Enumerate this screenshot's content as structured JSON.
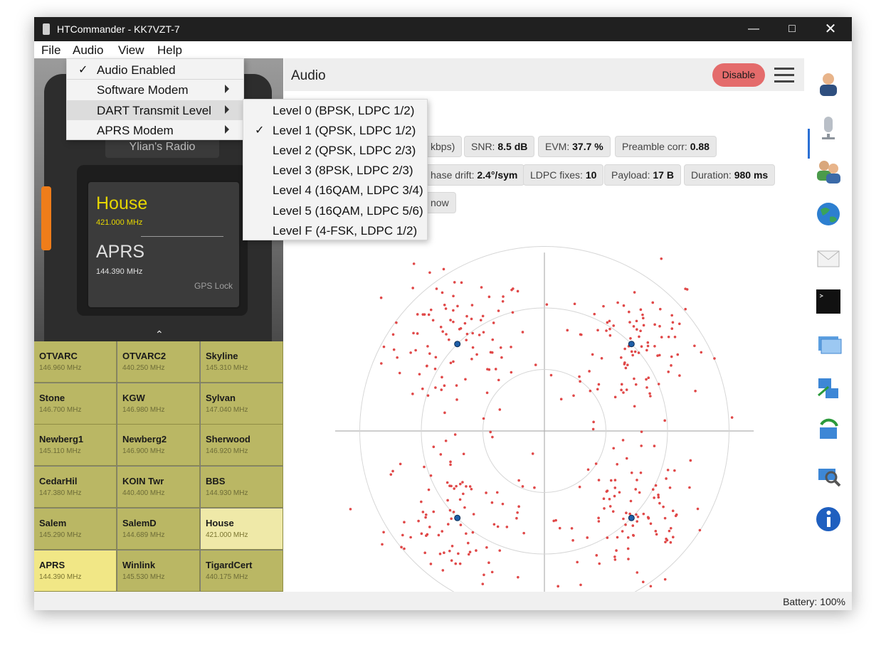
{
  "window": {
    "title": "HTCommander - KK7VZT-7"
  },
  "menubar": [
    "File",
    "Audio",
    "View",
    "Help"
  ],
  "audio_menu": [
    {
      "label": "Audio Enabled",
      "checked": true,
      "submenu": false
    },
    {
      "label": "Software Modem",
      "checked": false,
      "submenu": true
    },
    {
      "label": "DART Transmit Level",
      "checked": false,
      "submenu": true,
      "highlighted": true
    },
    {
      "label": "APRS Modem",
      "checked": false,
      "submenu": true
    }
  ],
  "dart_submenu": [
    {
      "label": "Level 0 (BPSK, LDPC 1/2)",
      "checked": false
    },
    {
      "label": "Level 1 (QPSK, LDPC 1/2)",
      "checked": true
    },
    {
      "label": "Level 2 (QPSK, LDPC 2/3)",
      "checked": false
    },
    {
      "label": "Level 3 (8PSK, LDPC 2/3)",
      "checked": false
    },
    {
      "label": "Level 4 (16QAM, LDPC 3/4)",
      "checked": false
    },
    {
      "label": "Level 5 (16QAM, LDPC 5/6)",
      "checked": false
    },
    {
      "label": "Level F (4-FSK, LDPC 1/2)",
      "checked": false
    }
  ],
  "radio": {
    "name": "Ylian's Radio",
    "channel_a": {
      "name": "House",
      "freq": "421.000 MHz"
    },
    "channel_b": {
      "name": "APRS",
      "freq": "144.390 MHz"
    },
    "gps": "GPS Lock"
  },
  "channels": [
    {
      "name": "OTVARC",
      "freq": "146.960 MHz"
    },
    {
      "name": "OTVARC2",
      "freq": "440.250 MHz"
    },
    {
      "name": "Skyline",
      "freq": "145.310 MHz"
    },
    {
      "name": "Stone",
      "freq": "146.700 MHz"
    },
    {
      "name": "KGW",
      "freq": "146.980 MHz"
    },
    {
      "name": "Sylvan",
      "freq": "147.040 MHz"
    },
    {
      "name": "Newberg1",
      "freq": "145.110 MHz"
    },
    {
      "name": "Newberg2",
      "freq": "146.900 MHz"
    },
    {
      "name": "Sherwood",
      "freq": "146.920 MHz"
    },
    {
      "name": "CedarHil",
      "freq": "147.380 MHz"
    },
    {
      "name": "KOIN Twr",
      "freq": "440.400 MHz"
    },
    {
      "name": "BBS",
      "freq": "144.930 MHz"
    },
    {
      "name": "Salem",
      "freq": "145.290 MHz"
    },
    {
      "name": "SalemD",
      "freq": "144.689 MHz"
    },
    {
      "name": "House",
      "freq": "421.000 MHz",
      "state": "selected-a"
    },
    {
      "name": "APRS",
      "freq": "144.390 MHz",
      "state": "selected-b"
    },
    {
      "name": "Winlink",
      "freq": "145.530 MHz"
    },
    {
      "name": "TigardCert",
      "freq": "440.175 MHz"
    }
  ],
  "audio_panel": {
    "title": "Audio",
    "disable_label": "Disable",
    "stats": [
      {
        "text": "kbps)"
      },
      {
        "label": "SNR: ",
        "value": "8.5 dB"
      },
      {
        "label": "EVM: ",
        "value": "37.7 %"
      },
      {
        "label": "Preamble corr: ",
        "value": "0.88"
      },
      {
        "label": "hase drift: ",
        "value": "2.4°/sym"
      },
      {
        "label": "LDPC fixes: ",
        "value": "10"
      },
      {
        "label": "Payload: ",
        "value": "17 B"
      },
      {
        "label": "Duration: ",
        "value": "980 ms"
      },
      {
        "text": "now"
      }
    ]
  },
  "sidebar_icons": [
    "contact-icon",
    "microphone-icon",
    "users-icon",
    "globe-icon",
    "mail-icon",
    "terminal-icon",
    "windows-icon",
    "network-icon",
    "sync-icon",
    "search-icon",
    "info-icon"
  ],
  "colors": {
    "accent": "#2a6fd4",
    "disable": "#e46b6b",
    "channel": "#bab764",
    "channel_selected": "#efe9a8",
    "dot": "#e04848",
    "ref_dot": "#1f5fa8"
  },
  "chart_data": {
    "type": "scatter",
    "title": "",
    "xlabel": "",
    "ylabel": "",
    "xlim": [
      -1.7,
      1.7
    ],
    "ylim": [
      -1.45,
      1.45
    ],
    "rings": [
      0.5,
      1.0,
      1.5
    ],
    "reference_points": [
      [
        -0.707,
        0.707
      ],
      [
        0.707,
        0.707
      ],
      [
        -0.707,
        -0.707
      ],
      [
        0.707,
        -0.707
      ]
    ],
    "samples": {
      "count": 400,
      "clusters": [
        [
          -0.707,
          0.707
        ],
        [
          0.707,
          0.707
        ],
        [
          -0.707,
          -0.707
        ],
        [
          0.707,
          -0.707
        ]
      ],
      "spread": 0.3,
      "evm_percent": 37.7
    }
  },
  "status": {
    "battery": "Battery: 100%"
  }
}
